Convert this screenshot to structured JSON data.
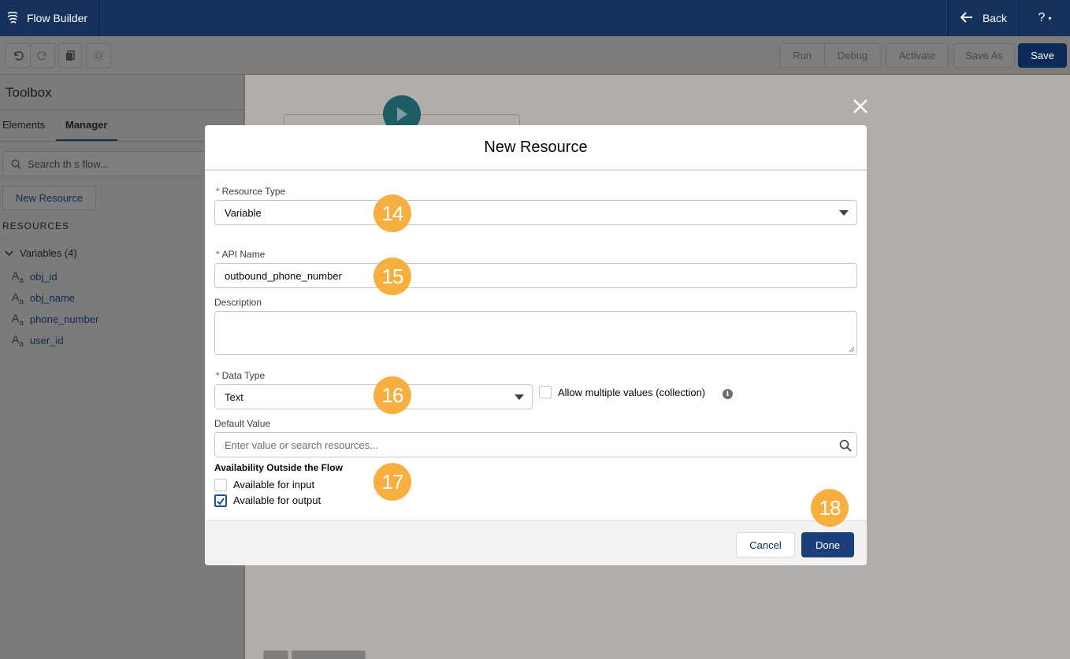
{
  "app": {
    "title": "Flow Builder",
    "back_label": "Back",
    "help_label": "?"
  },
  "toolbar": {
    "run": "Run",
    "debug": "Debug",
    "activate": "Activate",
    "save_as": "Save As",
    "save": "Save"
  },
  "toolbox": {
    "title": "Toolbox",
    "tabs": [
      "Elements",
      "Manager"
    ],
    "active_tab": "Manager",
    "search_placeholder": "Search th s flow...",
    "new_resource": "New Resource",
    "resources_label": "RESOURCES",
    "variables_header": "Variables (4)",
    "variables": [
      "obj_id",
      "obj_name",
      "phone_number",
      "user_id"
    ]
  },
  "modal": {
    "title": "New Resource",
    "resource_type_label": "Resource Type",
    "resource_type_value": "Variable",
    "api_name_label": "API Name",
    "api_name_value": "outbound_phone_number",
    "description_label": "Description",
    "description_value": "",
    "data_type_label": "Data Type",
    "data_type_value": "Text",
    "allow_multiple_label": "Allow multiple values (collection)",
    "allow_multiple_checked": false,
    "default_value_label": "Default Value",
    "default_value_placeholder": "Enter value or search resources...",
    "availability_title": "Availability Outside the Flow",
    "available_input_label": "Available for input",
    "available_input_checked": false,
    "available_output_label": "Available for output",
    "available_output_checked": true,
    "cancel": "Cancel",
    "done": "Done"
  },
  "step_badges": [
    "14",
    "15",
    "16",
    "17",
    "18"
  ],
  "colors": {
    "nav": "#16325c",
    "brand_button": "#1b3f7a",
    "badge": "#f7b03f",
    "required": "#c23934"
  }
}
